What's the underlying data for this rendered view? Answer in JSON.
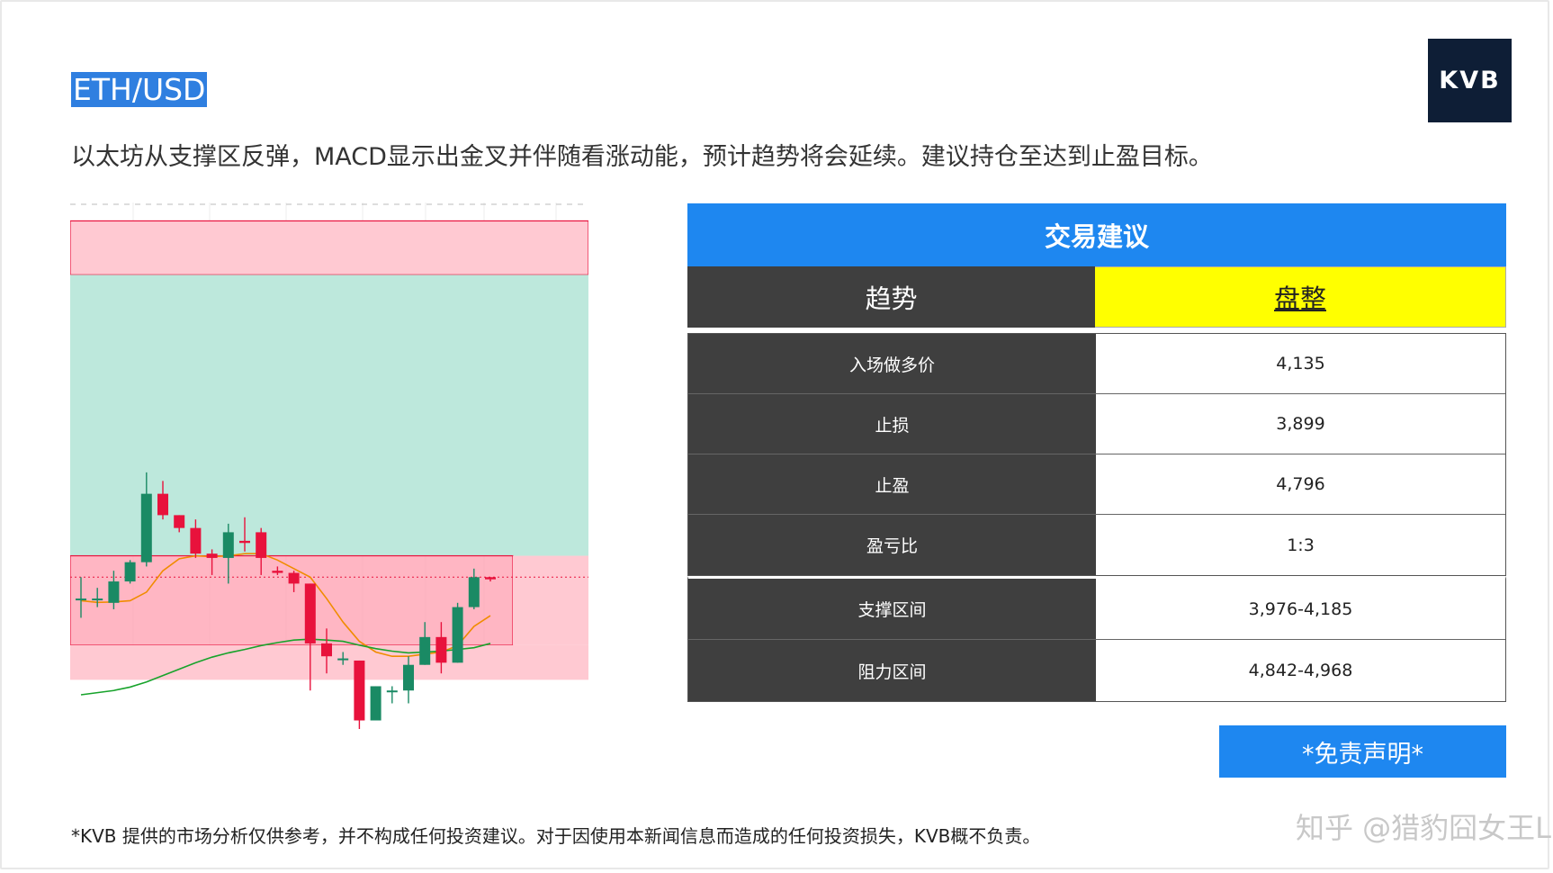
{
  "header": {
    "pair": "ETH/USD",
    "logo_text": "KVB",
    "summary": "以太坊从支撑区反弹，MACD显示出金叉并伴随看涨动能，预计趋势将会延续。建议持仓至达到止盈目标。"
  },
  "panel": {
    "title": "交易建议",
    "trend_label": "趋势",
    "trend_value": "盘整",
    "rows": [
      {
        "label": "入场做多价",
        "value": "4,135"
      },
      {
        "label": "止损",
        "value": "3,899"
      },
      {
        "label": "止盈",
        "value": "4,796"
      },
      {
        "label": "盈亏比",
        "value": "1:3"
      }
    ],
    "zones": [
      {
        "label": "支撑区间",
        "value": "3,976-4,185"
      },
      {
        "label": "阻力区间",
        "value": "4,842-4,968"
      }
    ]
  },
  "disclaimer_button": "*免责声明*",
  "footer_text": "*KVB 提供的市场分析仅供参考，并不构成任何投资建议。对于因使用本新闻信息而造成的任何投资损失，KVB概不负责。",
  "watermark": "知乎 @猎豹囧女王Li",
  "colors": {
    "up": "#1a8a64",
    "down": "#e8123c",
    "fast_ma": "#f08c00",
    "slow_ma": "#17a32b",
    "resistance_zone": "#ffc9d2",
    "support_zone": "#ff9daf",
    "range_zone": "#bde8dc",
    "accent": "#1e87f0"
  },
  "chart_data": {
    "type": "candlestick",
    "title": "",
    "xlabel": "",
    "ylabel": "",
    "ylim": [
      3780,
      4990
    ],
    "grid": true,
    "last_price": 4135,
    "candles": [
      {
        "o": 4085,
        "h": 4135,
        "l": 4040,
        "c": 4085
      },
      {
        "o": 4085,
        "h": 4110,
        "l": 4065,
        "c": 4085
      },
      {
        "o": 4075,
        "h": 4150,
        "l": 4060,
        "c": 4125
      },
      {
        "o": 4125,
        "h": 4175,
        "l": 4120,
        "c": 4170
      },
      {
        "o": 4170,
        "h": 4380,
        "l": 4160,
        "c": 4330
      },
      {
        "o": 4330,
        "h": 4360,
        "l": 4270,
        "c": 4280
      },
      {
        "o": 4280,
        "h": 4280,
        "l": 4240,
        "c": 4250
      },
      {
        "o": 4250,
        "h": 4270,
        "l": 4180,
        "c": 4190
      },
      {
        "o": 4190,
        "h": 4200,
        "l": 4140,
        "c": 4180
      },
      {
        "o": 4180,
        "h": 4260,
        "l": 4120,
        "c": 4240
      },
      {
        "o": 4220,
        "h": 4275,
        "l": 4195,
        "c": 4215
      },
      {
        "o": 4240,
        "h": 4250,
        "l": 4140,
        "c": 4180
      },
      {
        "o": 4150,
        "h": 4160,
        "l": 4140,
        "c": 4145
      },
      {
        "o": 4145,
        "h": 4150,
        "l": 4100,
        "c": 4120
      },
      {
        "o": 4120,
        "h": 4120,
        "l": 3870,
        "c": 3980
      },
      {
        "o": 3980,
        "h": 4015,
        "l": 3910,
        "c": 3950
      },
      {
        "o": 3945,
        "h": 3960,
        "l": 3930,
        "c": 3945
      },
      {
        "o": 3940,
        "h": 3940,
        "l": 3780,
        "c": 3800
      },
      {
        "o": 3800,
        "h": 3880,
        "l": 3800,
        "c": 3880
      },
      {
        "o": 3870,
        "h": 3880,
        "l": 3840,
        "c": 3870
      },
      {
        "o": 3870,
        "h": 3950,
        "l": 3840,
        "c": 3930
      },
      {
        "o": 3930,
        "h": 4030,
        "l": 3930,
        "c": 3995
      },
      {
        "o": 3995,
        "h": 4030,
        "l": 3910,
        "c": 3935
      },
      {
        "o": 3935,
        "h": 4075,
        "l": 3935,
        "c": 4065
      },
      {
        "o": 4065,
        "h": 4155,
        "l": 4060,
        "c": 4135
      },
      {
        "o": 4135,
        "h": 4135,
        "l": 4125,
        "c": 4130
      }
    ],
    "series": [
      {
        "values": [
          4080,
          4076,
          4077,
          4080,
          4100,
          4150,
          4178,
          4185,
          4183,
          4185,
          4190,
          4190,
          4175,
          4155,
          4135,
          4085,
          4030,
          3985,
          3960,
          3950,
          3950,
          3955,
          3960,
          3975,
          4020,
          4045
        ]
      },
      {
        "values": [
          3860,
          3865,
          3870,
          3878,
          3890,
          3905,
          3920,
          3935,
          3948,
          3958,
          3966,
          3975,
          3982,
          3988,
          3990,
          3988,
          3985,
          3976,
          3968,
          3962,
          3958,
          3960,
          3962,
          3966,
          3970,
          3980
        ]
      }
    ],
    "zones": [
      {
        "kind": "resistance",
        "from": 4842,
        "to": 4968
      },
      {
        "kind": "range",
        "from": 4185,
        "to": 4842
      },
      {
        "kind": "support",
        "from": 3976,
        "to": 4185
      },
      {
        "kind": "support-extension",
        "from": 3976,
        "to": 4185
      },
      {
        "kind": "lower",
        "from": 3895,
        "to": 3976
      }
    ]
  }
}
